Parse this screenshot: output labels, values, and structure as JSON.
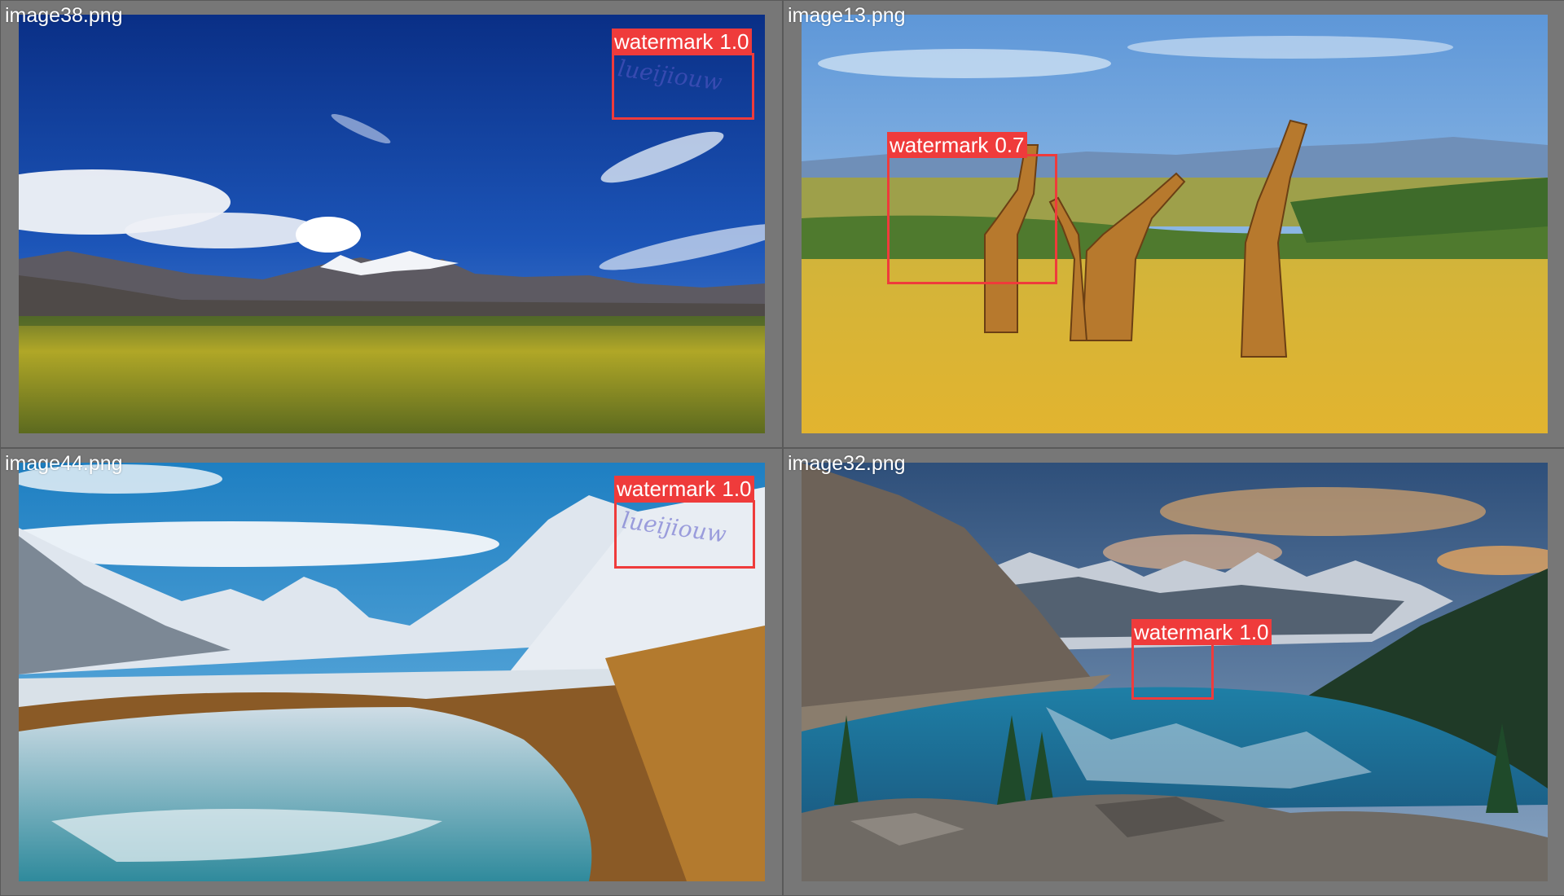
{
  "panels": [
    {
      "filename": "image38.png",
      "detection": {
        "label": "watermark",
        "confidence": "1.0"
      },
      "watermark_hint": "lueijiouw"
    },
    {
      "filename": "image13.png",
      "detection": {
        "label": "watermark",
        "confidence": "0.7"
      },
      "watermark_hint": ""
    },
    {
      "filename": "image44.png",
      "detection": {
        "label": "watermark",
        "confidence": "1.0"
      },
      "watermark_hint": "lueijiouw"
    },
    {
      "filename": "image32.png",
      "detection": {
        "label": "watermark",
        "confidence": "1.0"
      },
      "watermark_hint": ""
    }
  ],
  "colors": {
    "box": "#ef3b3b",
    "background": "#777777",
    "label_text": "#ffffff"
  }
}
